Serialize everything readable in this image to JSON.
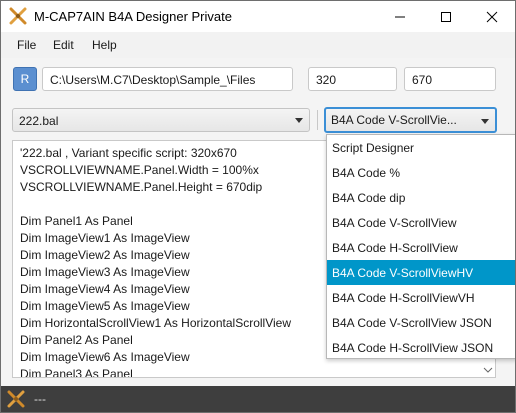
{
  "window": {
    "title": "M-CAP7AIN B4A Designer   Private",
    "controls": [
      "minimize",
      "maximize",
      "close"
    ]
  },
  "menu": {
    "file": "File",
    "edit": "Edit",
    "help": "Help"
  },
  "toolbar": {
    "r_button": "R",
    "path": "C:\\Users\\M.C7\\Desktop\\Sample_\\Files",
    "width": "320",
    "height": "670"
  },
  "layout_combo": {
    "value": "222.bal"
  },
  "mode_combo": {
    "value": "B4A Code V-ScrollVie..."
  },
  "code_lines": [
    "'222.bal , Variant specific script: 320x670",
    "VSCROLLVIEWNAME.Panel.Width = 100%x",
    "VSCROLLVIEWNAME.Panel.Height = 670dip",
    "",
    "Dim Panel1 As Panel",
    "Dim ImageView1 As ImageView",
    "Dim ImageView2 As ImageView",
    "Dim ImageView3 As ImageView",
    "Dim ImageView4 As ImageView",
    "Dim ImageView5 As ImageView",
    "Dim HorizontalScrollView1 As HorizontalScrollView",
    "Dim Panel2 As Panel",
    "Dim ImageView6 As ImageView",
    "Dim Panel3 As Panel"
  ],
  "dropdown": {
    "items": [
      "Script Designer",
      "B4A Code %",
      "B4A Code dip",
      "B4A Code V-ScrollView",
      "B4A Code H-ScrollView",
      "B4A Code V-ScrollViewHV",
      "B4A Code H-ScrollViewVH",
      "B4A Code V-ScrollView JSON",
      "B4A Code H-ScrollView JSON"
    ],
    "selected_index": 5
  },
  "status": {
    "text": "---"
  },
  "colors": {
    "accent": "#3b8fd6",
    "selection": "#0096c9",
    "r_button": "#5b8fd0",
    "statusbar": "#3e3e3e"
  }
}
